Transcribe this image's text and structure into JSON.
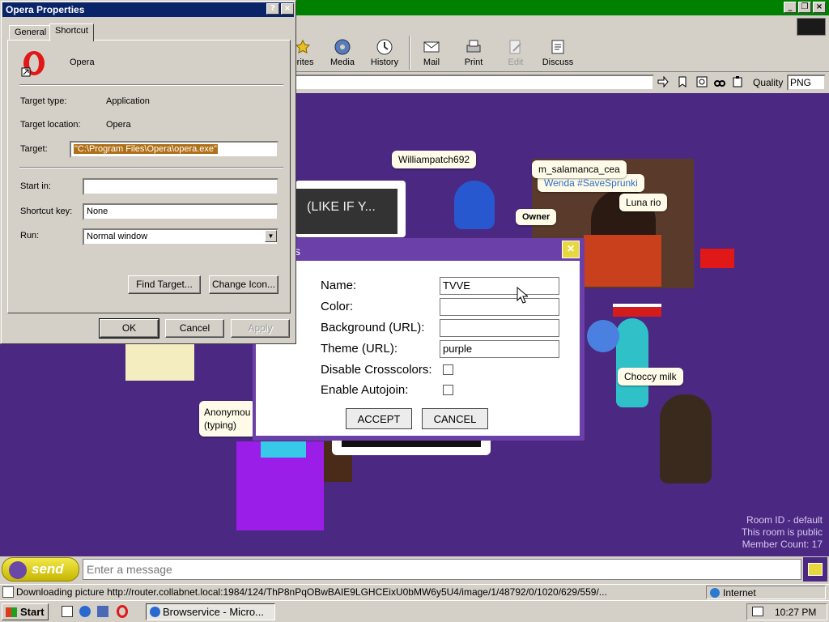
{
  "browser": {
    "toolbar": [
      {
        "label": "orites"
      },
      {
        "label": "Media"
      },
      {
        "label": "History"
      },
      {
        "label": "Mail"
      },
      {
        "label": "Print"
      },
      {
        "label": "Edit"
      },
      {
        "label": "Discuss"
      }
    ],
    "quality_label": "Quality",
    "quality_value": "PNG"
  },
  "props": {
    "title": "Opera Properties",
    "tabs": [
      "General",
      "Shortcut"
    ],
    "app_name": "Opera",
    "target_type_label": "Target type:",
    "target_type": "Application",
    "target_location_label": "Target location:",
    "target_location": "Opera",
    "target_label": "Target:",
    "target_value": "\"C:\\Program Files\\Opera\\opera.exe\"",
    "start_in_label": "Start in:",
    "start_in_value": "",
    "shortcut_key_label": "Shortcut key:",
    "shortcut_key_value": "None",
    "run_label": "Run:",
    "run_value": "Normal window",
    "find_target": "Find Target...",
    "change_icon": "Change Icon...",
    "ok": "OK",
    "cancel": "Cancel",
    "apply": "Apply"
  },
  "room": {
    "bubbles": [
      "Williampatch692",
      "m_salamanca_cea",
      "Wenda #SaveSprunki",
      "Luna rio",
      "Owner",
      "Choccy milk",
      "(LIKE IF Y...",
      "Anonymou",
      "(typing)"
    ],
    "info": [
      "Room ID - default",
      "This room is public",
      "Member Count: 17"
    ]
  },
  "settings": {
    "title": "s",
    "fields": [
      {
        "label": "Name:",
        "value": "TVVE"
      },
      {
        "label": "Color:",
        "value": ""
      },
      {
        "label": "Background (URL):",
        "value": ""
      },
      {
        "label": "Theme (URL):",
        "value": "purple"
      }
    ],
    "checks": [
      {
        "label": "Disable Crosscolors:",
        "checked": false
      },
      {
        "label": "Enable Autojoin:",
        "checked": false
      }
    ],
    "accept": "ACCEPT",
    "cancel": "CANCEL"
  },
  "chat": {
    "send_label": "send",
    "input_placeholder": "Enter a message"
  },
  "status": {
    "text": "Downloading picture http://router.collabnet.local:1984/124/ThP8nPqOBwBAIE9LGHCEixU0bMW6y5U4/image/1/48792/0/1020/629/559/...",
    "zone": "Internet"
  },
  "taskbar": {
    "start": "Start",
    "task": "Browservice - Micro...",
    "time": "10:27 PM"
  },
  "colors": {
    "room_bg": "#4b2882",
    "dialog_title": "#0a246a",
    "settings_frame": "#6b40a8"
  }
}
